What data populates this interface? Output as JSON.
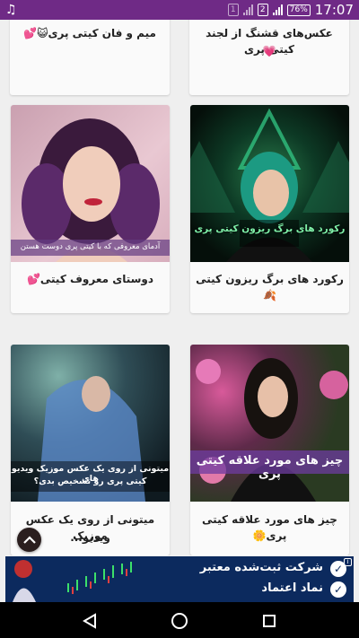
{
  "status_bar": {
    "time": "17:07",
    "battery": "76%",
    "sim1": "1",
    "sim2": "2"
  },
  "feed": {
    "cards": [
      {
        "title": "عکس‌های قشنگ از لجند کیتی پری",
        "emoji": "💗"
      },
      {
        "title": "میم و فان کیتی پری😺💕"
      },
      {
        "title": "رکورد های برگ ریزون کیتی🍂",
        "image_caption": "رکورد های برگ ریزون کیتی پری"
      },
      {
        "title": "دوستای معروف کیتی💕",
        "image_caption": "آدمای معروفی که با کیتی پری دوست هستن"
      },
      {
        "title": "چیز های مورد علاقه کیتی پری🌼",
        "image_caption": "چیز های مورد علاقه کیتی پری"
      },
      {
        "title_line1": "میتونی از روی یک عکس موزیک",
        "title_line2": "ویدیو...",
        "image_caption_line1": "میتونی از روی یک عکس موزیک ویدیو های",
        "image_caption_line2": "کیتی پری رو تشخیص بدی؟"
      }
    ]
  },
  "ad": {
    "line1": "شرکت ثبت‌شده معتبر",
    "line2": "نماد اعتماد"
  },
  "colors": {
    "status_bar": "#6f2a86",
    "ad_background": "#0c2a5e"
  },
  "icons": [
    "music-note-icon",
    "chevron-up-icon",
    "back-icon",
    "home-icon",
    "recents-icon"
  ]
}
